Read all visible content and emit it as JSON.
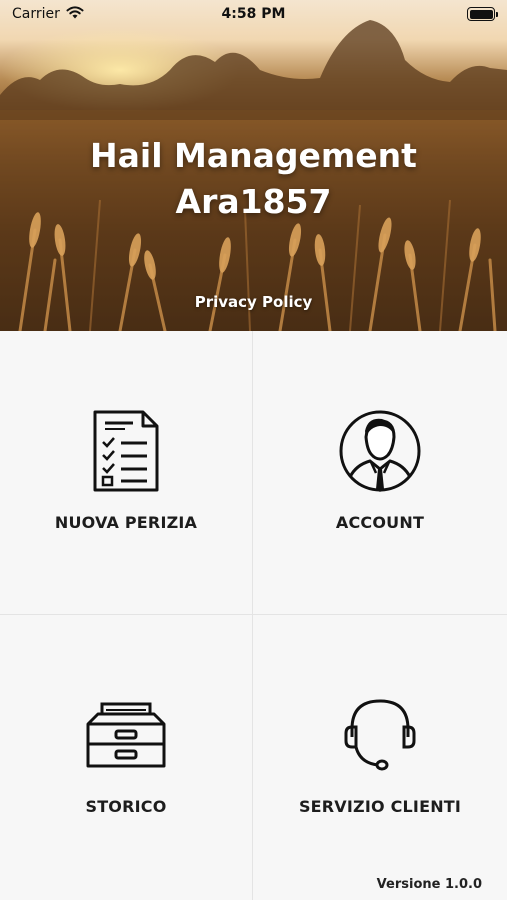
{
  "status_bar": {
    "carrier": "Carrier",
    "time": "4:58 PM",
    "icons": [
      "wifi-icon",
      "battery-icon"
    ]
  },
  "hero": {
    "title_line1": "Hail Management",
    "title_line2": "Ara1857",
    "privacy_link": "Privacy Policy",
    "image": "wheat-field-sunset"
  },
  "menu": {
    "items": [
      {
        "label": "NUOVA PERIZIA",
        "icon": "checklist-document-icon"
      },
      {
        "label": "ACCOUNT",
        "icon": "user-avatar-icon"
      },
      {
        "label": "STORICO",
        "icon": "archive-drawer-icon"
      },
      {
        "label": "SERVIZIO CLIENTI",
        "icon": "headset-icon"
      }
    ]
  },
  "footer": {
    "version": "Versione 1.0.0"
  },
  "colors": {
    "background": "#f7f7f7",
    "divider": "#e4e4e4",
    "text": "#1d1d1d",
    "hero_text": "#ffffff"
  }
}
